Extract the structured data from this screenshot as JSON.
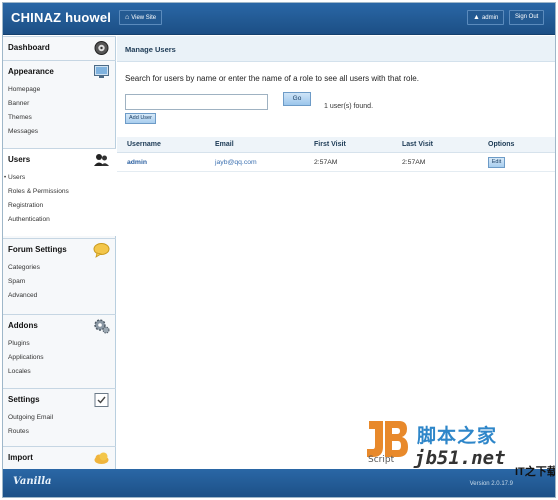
{
  "header": {
    "brand": "CHINAZ huowel",
    "view_site": "View Site",
    "admin": "admin",
    "sign_out": "Sign Out"
  },
  "sidebar": {
    "sections": [
      {
        "title": "Dashboard",
        "icon": "dashboard-gauge-icon",
        "items": []
      },
      {
        "title": "Appearance",
        "icon": "monitor-icon",
        "items": [
          "Homepage",
          "Banner",
          "Themes",
          "Messages"
        ]
      },
      {
        "title": "Users",
        "icon": "users-icon",
        "items": [
          "Users",
          "Roles & Permissions",
          "Registration",
          "Authentication"
        ],
        "current": "Users"
      },
      {
        "title": "Forum Settings",
        "icon": "speech-bubble-icon",
        "items": [
          "Categories",
          "Spam",
          "Advanced"
        ]
      },
      {
        "title": "Addons",
        "icon": "gears-icon",
        "items": [
          "Plugins",
          "Applications",
          "Locales"
        ]
      },
      {
        "title": "Settings",
        "icon": "checklist-icon",
        "items": [
          "Outgoing Email",
          "Routes"
        ]
      },
      {
        "title": "Import",
        "icon": "cloud-icon",
        "items": []
      }
    ]
  },
  "main": {
    "title": "Manage Users",
    "search_help": "Search for users by name or enter the name of a role to see all users with that role.",
    "search_value": "",
    "go_label": "Go",
    "add_user_label": "Add User",
    "found_text": "1 user(s) found.",
    "table": {
      "columns": [
        "Username",
        "Email",
        "First Visit",
        "Last Visit",
        "Options"
      ],
      "rows": [
        {
          "username": "admin",
          "email": "jayb@qq.com",
          "first_visit": "2:57AM",
          "last_visit": "2:57AM",
          "option": "Edit"
        }
      ]
    }
  },
  "footer": {
    "logo": "Vanilla",
    "version": "Version 2.0.17.9"
  },
  "watermark": {
    "script": "Script",
    "cn": "脚本之家",
    "url": "jb51.net",
    "corner": "IT之下载网"
  },
  "colors": {
    "header_blue": "#1f5a95",
    "link_blue": "#2a5fa0",
    "sidebar_bg": "#f6f8fa",
    "watermark_blue": "#2e86c9",
    "watermark_orange": "#e8892b"
  }
}
